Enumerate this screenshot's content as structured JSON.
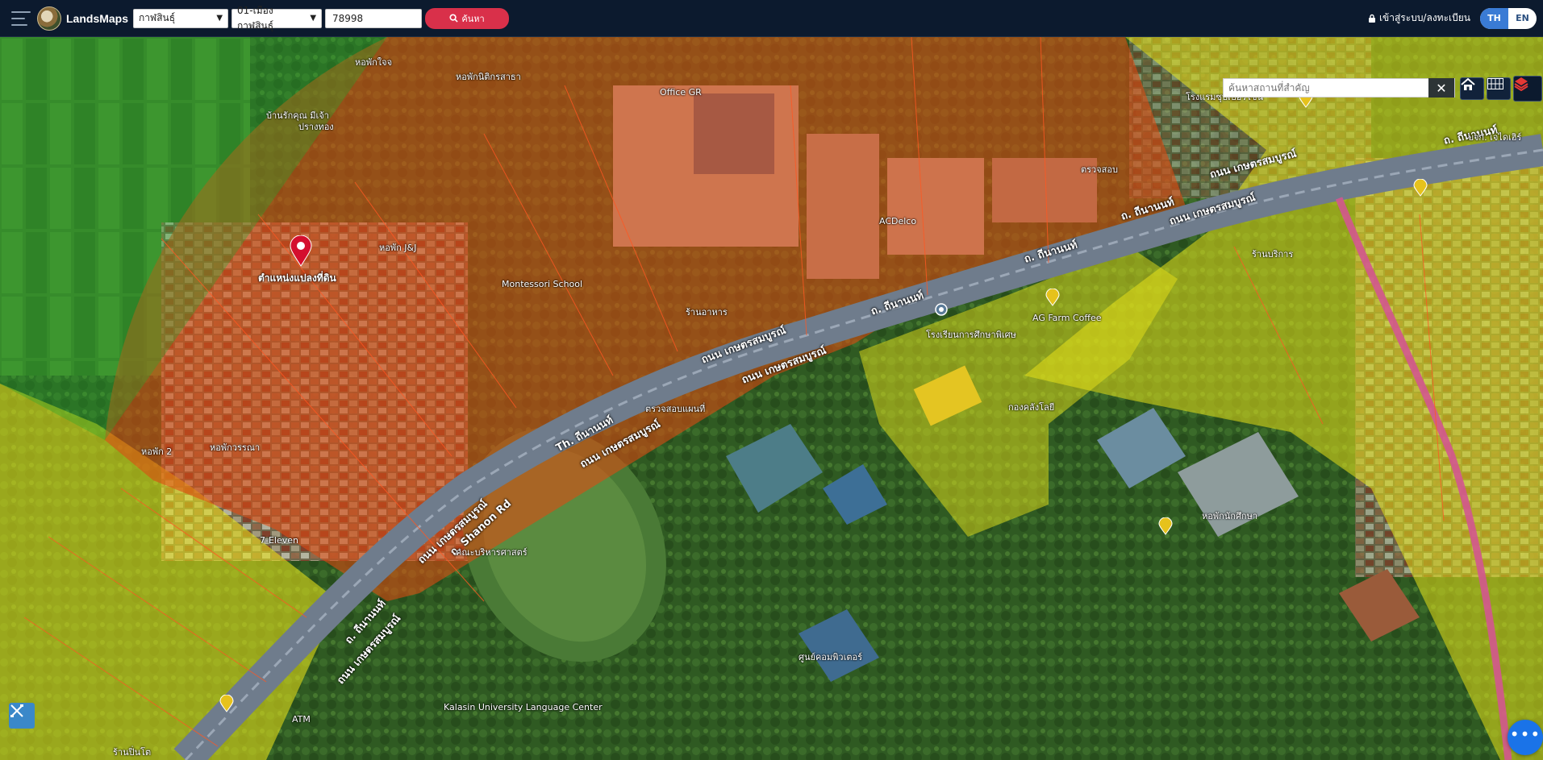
{
  "header": {
    "app_title": "LandsMaps",
    "province_select": "กาฬสินธุ์",
    "district_select": "01-เมืองกาฬสินธุ์",
    "parcel_input": "78998",
    "search_button": "ค้นหา",
    "login_label": "เข้าสู่ระบบ/ลงทะเบียน",
    "lang_th": "TH",
    "lang_en": "EN"
  },
  "map_controls": {
    "place_search_placeholder": "ค้นหาสถานที่สำคัญ",
    "clear_symbol": "✕",
    "home_icon": "home-icon",
    "grid_icon": "grid-icon",
    "layers_icon": "layers-icon",
    "measure_icon": "measure-icon",
    "chat_icon": "chat-icon"
  },
  "map": {
    "marker_label": "ตำแหน่งแปลงที่ดิน",
    "road_labels": [
      "ถ. ถีนานนท์",
      "ถนน เกษตรสมบูรณ์",
      "ถ. ถีนานนท์",
      "ถนน เกษตรสมบูรณ์",
      "ถ. ถีนานนท์",
      "ถนน เกษตรสมบูรณ์",
      "ถ. ถีนานนท์",
      "ถนน เกษตรสมบูรณ์",
      "Th. ถีนานนท์",
      "ถนน เกษตรสมบูรณ์",
      "ถ. Shanon Rd",
      "ถนน เกษตรสมบูรณ์",
      "ถ. ถีนานนท์",
      "ถนน เกษตรสมบูรณ์"
    ],
    "places": [
      "หอพักใจจ",
      "หอพักนิติกรสาธา",
      "บ้านรักคุณ มีเจ้า",
      "ปรางทอง",
      "Office GR",
      "โรงแรมซุปเปอร์โซน",
      "บจก. เจไดเฮิร์",
      "หอพัก J&J",
      "ตรวจสอบ",
      "ACDelco",
      "Montessori School",
      "ร้านอาหาร",
      "AG Farm Coffee",
      "โรงเรียนการศึกษาพิเศษ",
      "กองคลังโลยี",
      "หอพัก 2",
      "7-Eleven",
      "คณะบริหารศาสตร์",
      "ร้านบริการ",
      "ศูนย์คอมพิวเตอร์",
      "หอพักนักศึกษา",
      "Kalasin University Language Center",
      "ATM",
      "ร้านปิ่นโต",
      "ตรวจสอบแผนที่",
      "หอพักวรรณา"
    ]
  }
}
